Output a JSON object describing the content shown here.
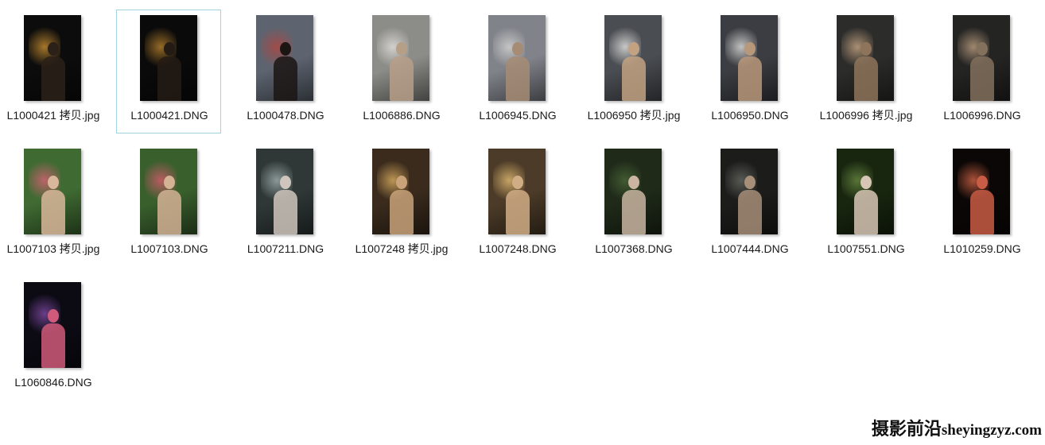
{
  "files": [
    {
      "name": "L1000421 拷贝.jpg",
      "bg": "#0c0c0c",
      "accent": "#d99a35",
      "figure": "#2b2119"
    },
    {
      "name": "L1000421.DNG",
      "bg": "#0a0a0a",
      "accent": "#c48a31",
      "figure": "#251b15"
    },
    {
      "name": "L1000478.DNG",
      "bg": "#5d6470",
      "accent": "#b7433c",
      "figure": "#1b1514"
    },
    {
      "name": "L1006886.DNG",
      "bg": "#8c8c88",
      "accent": "#e9e7e2",
      "figure": "#b69f87"
    },
    {
      "name": "L1006945.DNG",
      "bg": "#80838a",
      "accent": "#dcdad8",
      "figure": "#a68c74"
    },
    {
      "name": "L1006950 拷贝.jpg",
      "bg": "#4a4d52",
      "accent": "#f1f0ee",
      "figure": "#c2a281"
    },
    {
      "name": "L1006950.DNG",
      "bg": "#3b3d42",
      "accent": "#eeecea",
      "figure": "#b8987a"
    },
    {
      "name": "L1006996 拷贝.jpg",
      "bg": "#2c2c2b",
      "accent": "#d4b08a",
      "figure": "#8e745a"
    },
    {
      "name": "L1006996.DNG",
      "bg": "#242423",
      "accent": "#c8a888",
      "figure": "#83705d"
    },
    {
      "name": "L1007103 拷贝.jpg",
      "bg": "#3f6a32",
      "accent": "#e6607a",
      "figure": "#d9b79a"
    },
    {
      "name": "L1007103.DNG",
      "bg": "#395f2d",
      "accent": "#e45a72",
      "figure": "#d4b294"
    },
    {
      "name": "L1007211.DNG",
      "bg": "#2f3837",
      "accent": "#a8b8b6",
      "figure": "#cfc5bd"
    },
    {
      "name": "L1007248 拷贝.jpg",
      "bg": "#3a2b1d",
      "accent": "#e8b865",
      "figure": "#c9a27a"
    },
    {
      "name": "L1007248.DNG",
      "bg": "#4c3b28",
      "accent": "#f0c77a",
      "figure": "#d1ad86"
    },
    {
      "name": "L1007368.DNG",
      "bg": "#1f2a19",
      "accent": "#4d6a3a",
      "figure": "#c9b5a1"
    },
    {
      "name": "L1007444.DNG",
      "bg": "#1c1d1b",
      "accent": "#6b6d66",
      "figure": "#a78e78"
    },
    {
      "name": "L1007551.DNG",
      "bg": "#18260f",
      "accent": "#6e8f45",
      "figure": "#d7c5b5"
    },
    {
      "name": "L1010259.DNG",
      "bg": "#0b0706",
      "accent": "#e06a4a",
      "figure": "#c85c44"
    },
    {
      "name": "L1060846.DNG",
      "bg": "#0c0b14",
      "accent": "#8a4fb0",
      "figure": "#d05a7a"
    }
  ],
  "watermark": {
    "cn": "摄影前沿",
    "domain": "sheyingzyz.com"
  },
  "selected_index": 1
}
